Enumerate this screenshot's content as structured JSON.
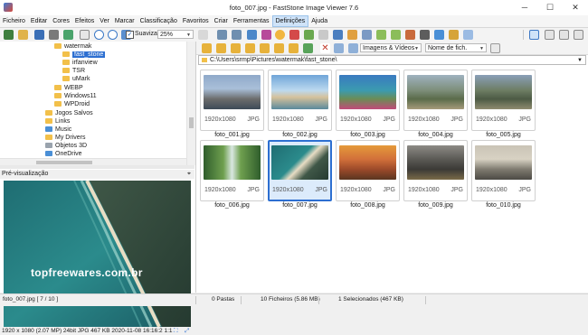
{
  "window": {
    "title": "foto_007.jpg  -  FastStone Image Viewer 7.6"
  },
  "menu": [
    "Ficheiro",
    "Editar",
    "Cores",
    "Efeitos",
    "Ver",
    "Marcar",
    "Classificação",
    "Favoritos",
    "Criar",
    "Ferramentas",
    "Definições",
    "Ajuda"
  ],
  "toolbar": {
    "smooth_label": "Suavizar",
    "zoom_value": "25%"
  },
  "tree": {
    "items": [
      {
        "label": "watermak"
      },
      {
        "label": "fast_stone"
      },
      {
        "label": "irfanview"
      },
      {
        "label": "TSR"
      },
      {
        "label": "uMark"
      },
      {
        "label": "WEBP"
      },
      {
        "label": "Windows11"
      },
      {
        "label": "WPDroid"
      },
      {
        "label": "Jogos Salvos"
      },
      {
        "label": "Links"
      },
      {
        "label": "Music"
      },
      {
        "label": "My Drivers"
      },
      {
        "label": "Objetos 3D"
      },
      {
        "label": "OneDrive"
      }
    ]
  },
  "preview": {
    "header": "Pré-visualização",
    "watermark": "topfreewares.com.br",
    "info": "1920 x 1080 (2.07 MP)  24bit  JPG   467 KB   2020-11-08 16:16:2 1:1"
  },
  "filter": {
    "type_value": "Imagens & Vídeos",
    "sort_value": "Nome de fich."
  },
  "address": "C:\\Users\\srmp\\Pictures\\watermak\\fast_stone\\",
  "thumbnails": [
    {
      "name": "foto_001.jpg",
      "res": "1920x1080",
      "fmt": "JPG"
    },
    {
      "name": "foto_002.jpg",
      "res": "1920x1080",
      "fmt": "JPG"
    },
    {
      "name": "foto_003.jpg",
      "res": "1920x1080",
      "fmt": "JPG"
    },
    {
      "name": "foto_004.jpg",
      "res": "1920x1080",
      "fmt": "JPG"
    },
    {
      "name": "foto_005.jpg",
      "res": "1920x1080",
      "fmt": "JPG"
    },
    {
      "name": "foto_006.jpg",
      "res": "1920x1080",
      "fmt": "JPG"
    },
    {
      "name": "foto_007.jpg",
      "res": "1920x1080",
      "fmt": "JPG"
    },
    {
      "name": "foto_008.jpg",
      "res": "1920x1080",
      "fmt": "JPG"
    },
    {
      "name": "foto_009.jpg",
      "res": "1920x1080",
      "fmt": "JPG"
    },
    {
      "name": "foto_010.jpg",
      "res": "1920x1080",
      "fmt": "JPG"
    }
  ],
  "status": {
    "file": "foto_007.jpg [ 7 / 10 ]",
    "folders": "0 Pastas",
    "files": "10 Ficheiros (5.86 MB)",
    "selected": "1 Selecionados (467 KB)"
  }
}
